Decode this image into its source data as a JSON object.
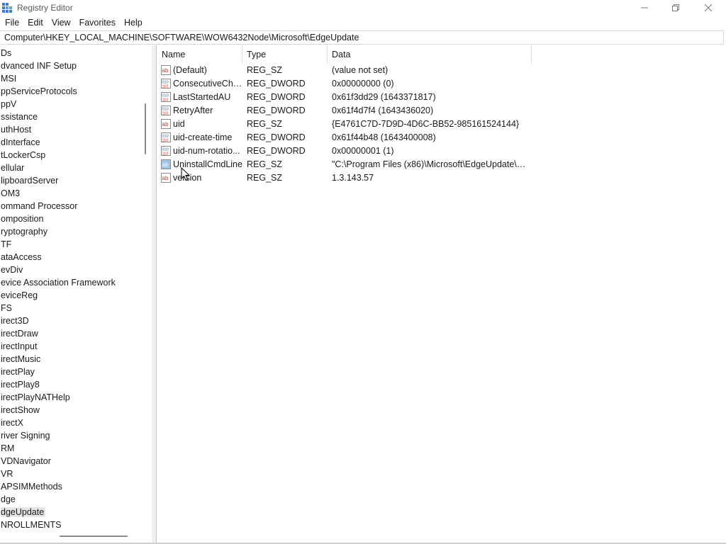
{
  "window": {
    "title": "Registry Editor"
  },
  "menu": [
    "File",
    "Edit",
    "View",
    "Favorites",
    "Help"
  ],
  "address": "Computer\\HKEY_LOCAL_MACHINE\\SOFTWARE\\WOW6432Node\\Microsoft\\EdgeUpdate",
  "tree": {
    "items": [
      "Ds",
      "dvanced INF Setup",
      "MSI",
      "ppServiceProtocols",
      "ppV",
      "ssistance",
      "uthHost",
      "dInterface",
      "tLockerCsp",
      "ellular",
      "lipboardServer",
      "OM3",
      "ommand Processor",
      "omposition",
      "ryptography",
      "TF",
      "ataAccess",
      "evDiv",
      "evice Association Framework",
      "eviceReg",
      "FS",
      "irect3D",
      "irectDraw",
      "irectInput",
      "irectMusic",
      "irectPlay",
      "irectPlay8",
      "irectPlayNATHelp",
      "irectShow",
      "irectX",
      "river Signing",
      "RM",
      "VDNavigator",
      "VR",
      "APSIMMethods",
      "dge",
      "dgeUpdate",
      "NROLLMENTS"
    ],
    "selected_index": 36
  },
  "values": {
    "headers": {
      "name": "Name",
      "type": "Type",
      "data": "Data"
    },
    "rows": [
      {
        "icon": "string-value-icon",
        "name": "(Default)",
        "type": "REG_SZ",
        "data": "(value not set)"
      },
      {
        "icon": "binary-value-icon",
        "name": "ConsecutiveChe...",
        "type": "REG_DWORD",
        "data": "0x00000000 (0)"
      },
      {
        "icon": "binary-value-icon",
        "name": "LastStartedAU",
        "type": "REG_DWORD",
        "data": "0x61f3dd29 (1643371817)"
      },
      {
        "icon": "binary-value-icon",
        "name": "RetryAfter",
        "type": "REG_DWORD",
        "data": "0x61f4d7f4 (1643436020)"
      },
      {
        "icon": "string-value-icon",
        "name": "uid",
        "type": "REG_SZ",
        "data": "{E4761C7D-7D9D-4D6C-BB52-985161524144}"
      },
      {
        "icon": "binary-value-icon",
        "name": "uid-create-time",
        "type": "REG_DWORD",
        "data": "0x61f44b48 (1643400008)"
      },
      {
        "icon": "binary-value-icon",
        "name": "uid-num-rotatio...",
        "type": "REG_DWORD",
        "data": "0x00000001 (1)"
      },
      {
        "icon": "string-value-icon",
        "name": "UninstallCmdLine",
        "type": "REG_SZ",
        "data": "\"C:\\Program Files (x86)\\Microsoft\\EdgeUpdate\\Mi...",
        "highlighted": true
      },
      {
        "icon": "string-value-icon",
        "name": "version",
        "type": "REG_SZ",
        "data": "1.3.143.57"
      }
    ]
  },
  "colors": {
    "string_icon_red": "#c0392b",
    "binary_icon_blue": "#2b5fa8",
    "selection_gray": "#e5e5e5"
  }
}
